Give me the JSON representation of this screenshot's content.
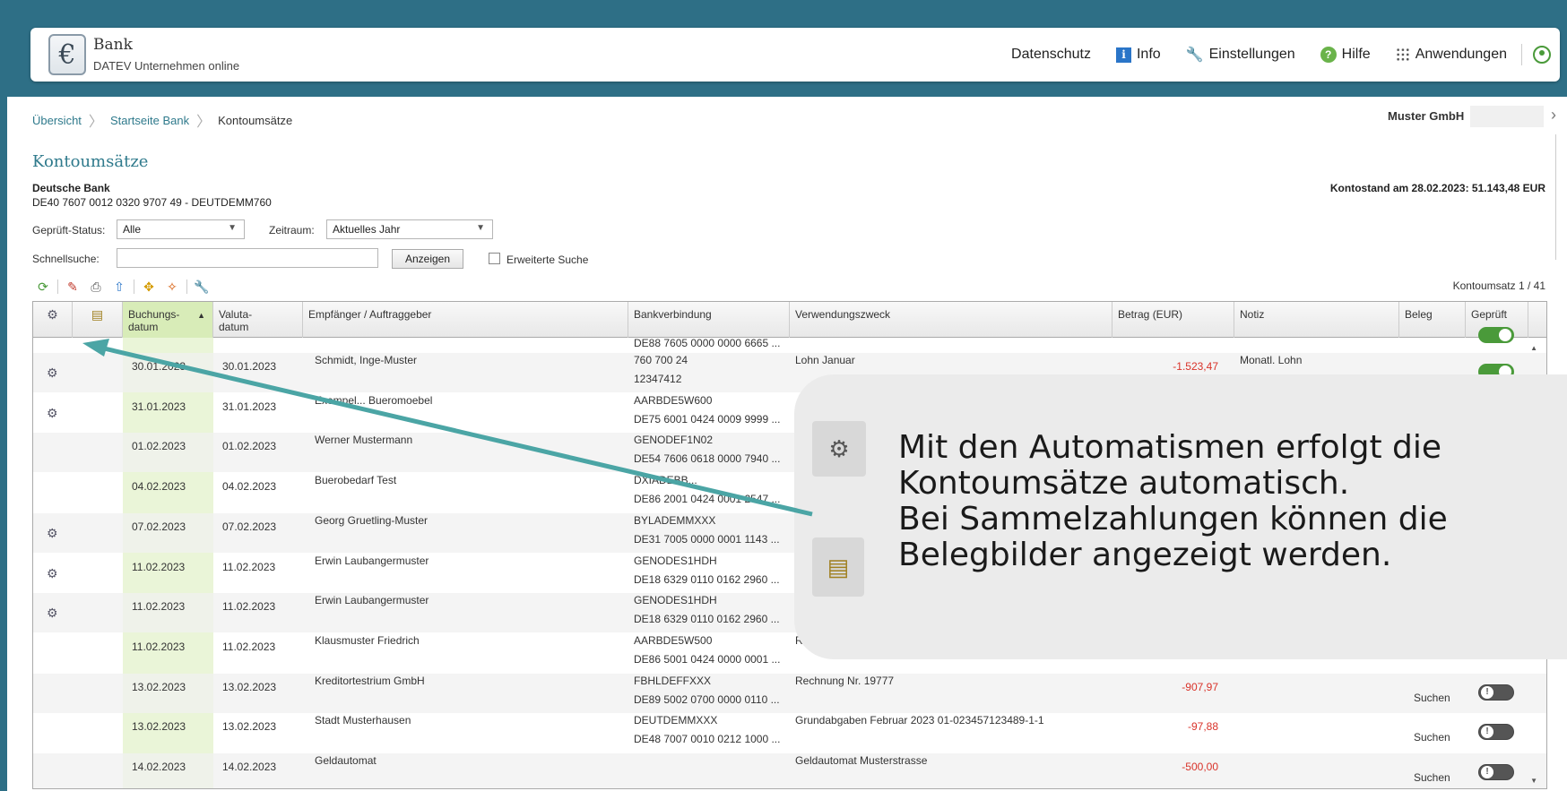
{
  "header": {
    "app_title": "Bank",
    "app_subtitle": "DATEV Unternehmen online",
    "logo_symbol": "€",
    "nav": {
      "datenschutz": "Datenschutz",
      "info": "Info",
      "einstellungen": "Einstellungen",
      "hilfe": "Hilfe",
      "anwendungen": "Anwendungen"
    }
  },
  "breadcrumb": {
    "items": [
      "Übersicht",
      "Startseite Bank",
      "Kontoumsätze"
    ]
  },
  "company": "Muster GmbH",
  "page": {
    "title": "Kontoumsätze",
    "bank_name": "Deutsche Bank",
    "iban": "DE40 7607 0012 0320 9707 49 - DEUTDEMM760",
    "balance": "Kontostand am 28.02.2023: 51.143,48 EUR"
  },
  "filters": {
    "status_label": "Geprüft-Status:",
    "status_value": "Alle",
    "period_label": "Zeitraum:",
    "period_value": "Aktuelles Jahr",
    "quicksearch_label": "Schnellsuche:",
    "quicksearch_value": "",
    "show_button": "Anzeigen",
    "extended_search": "Erweiterte Suche"
  },
  "counter": "Kontoumsatz 1 / 41",
  "table": {
    "headers": {
      "booking": "Buchungs- datum",
      "value": "Valuta- datum",
      "party": "Empfänger / Auftraggeber",
      "bank": "Bankverbindung",
      "purpose": "Verwendungszweck",
      "amount": "Betrag (EUR)",
      "note": "Notiz",
      "receipt": "Beleg",
      "checked": "Geprüft"
    },
    "partial_row_bank": "DE88 7605 0000 0000 6665 ...",
    "rows": [
      {
        "gear": true,
        "booking": "30.01.2023",
        "value": "30.01.2023",
        "party": "Schmidt, Inge-Muster",
        "bank1": "760 700 24",
        "bank2": "12347412",
        "purpose": "Lohn Januar",
        "amount": "-1.523,47",
        "note": "Monatl. Lohn",
        "receipt": "",
        "toggle": "on"
      },
      {
        "gear": true,
        "booking": "31.01.2023",
        "value": "31.01.2023",
        "party": "Exempel... Bueromoebel",
        "bank1": "AARBDE5W600",
        "bank2": "DE75 6001 0424 0009 9999 ...",
        "purpose": "",
        "amount": "",
        "note": "",
        "receipt": "",
        "toggle": ""
      },
      {
        "gear": false,
        "booking": "01.02.2023",
        "value": "01.02.2023",
        "party": "Werner Mustermann",
        "bank1": "GENODEF1N02",
        "bank2": "DE54 7606 0618 0000 7940 ...",
        "purpose": "",
        "amount": "",
        "note": "",
        "receipt": "",
        "toggle": ""
      },
      {
        "gear": false,
        "booking": "04.02.2023",
        "value": "04.02.2023",
        "party": "Buerobedarf Test",
        "bank1": "DXIADEBB...",
        "bank2": "DE86 2001 0424 0001 2547 ...",
        "purpose": "",
        "amount": "",
        "note": "",
        "receipt": "",
        "toggle": ""
      },
      {
        "gear": true,
        "booking": "07.02.2023",
        "value": "07.02.2023",
        "party": "Georg Gruetling-Muster",
        "bank1": "BYLADEMMXXX",
        "bank2": "DE31 7005 0000 0001 1143 ...",
        "purpose": "",
        "amount": "",
        "note": "",
        "receipt": "",
        "toggle": ""
      },
      {
        "gear": true,
        "booking": "11.02.2023",
        "value": "11.02.2023",
        "party": "Erwin Laubangermuster",
        "bank1": "GENODES1HDH",
        "bank2": "DE18 6329 0110 0162 2960 ...",
        "purpose": "",
        "amount": "",
        "note": "",
        "receipt": "",
        "toggle": ""
      },
      {
        "gear": true,
        "booking": "11.02.2023",
        "value": "11.02.2023",
        "party": "Erwin Laubangermuster",
        "bank1": "GENODES1HDH",
        "bank2": "DE18 6329 0110 0162 2960 ...",
        "purpose": "",
        "amount": "",
        "note": "",
        "receipt": "",
        "toggle": ""
      },
      {
        "gear": false,
        "booking": "11.02.2023",
        "value": "11.02.2023",
        "party": "Klausmuster Friedrich",
        "bank1": "AARBDE5W500",
        "bank2": "DE86 5001 0424 0000 0001 ...",
        "purpose": "Re",
        "amount": "",
        "note": "",
        "receipt": "",
        "toggle": ""
      },
      {
        "gear": false,
        "booking": "13.02.2023",
        "value": "13.02.2023",
        "party": "Kreditortestrium GmbH",
        "bank1": "FBHLDEFFXXX",
        "bank2": "DE89 5002 0700 0000 0110 ...",
        "purpose": "Rechnung Nr. 19777",
        "amount": "-907,97",
        "note": "",
        "receipt": "Suchen",
        "toggle": "off"
      },
      {
        "gear": false,
        "booking": "13.02.2023",
        "value": "13.02.2023",
        "party": "Stadt Musterhausen",
        "bank1": "DEUTDEMMXXX",
        "bank2": "DE48 7007 0010 0212 1000 ...",
        "purpose": "Grundabgaben Februar 2023 01-023457123489-1-1",
        "amount": "-97,88",
        "note": "",
        "receipt": "Suchen",
        "toggle": "off"
      },
      {
        "gear": false,
        "booking": "14.02.2023",
        "value": "14.02.2023",
        "party": "Geldautomat",
        "bank1": "",
        "bank2": "",
        "purpose": "Geldautomat Musterstrasse",
        "amount": "-500,00",
        "note": "",
        "receipt": "Suchen",
        "toggle": "off"
      }
    ]
  },
  "callout": {
    "lines": [
      "Mit den Automatismen erfolgt die",
      "Kontoumsätze automatisch.",
      "Bei Sammelzahlungen können die",
      "Belegbilder angezeigt werden."
    ]
  },
  "colors": {
    "frame": "#2e6f86",
    "arrow": "#4ba5a5",
    "link": "#2f7a8c",
    "negative": "#d9332a",
    "toggle_on": "#4a9a3a"
  }
}
